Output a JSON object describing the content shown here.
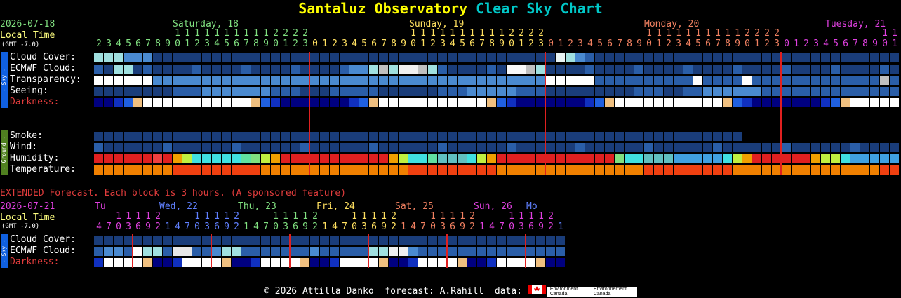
{
  "title": {
    "part1": "Santaluz Observatory",
    "part2": "Clear Sky Chart"
  },
  "header": {
    "date": "2026-07-21",
    "date_top": "2026-07-18",
    "local_time": "Local Time",
    "gmt": "(GMT -7.0)",
    "days": [
      {
        "label": "Saturday, 18",
        "color": "#80e080"
      },
      {
        "label": "Sunday, 19",
        "color": "#ffe060"
      },
      {
        "label": "Monday, 20",
        "color": "#f08060"
      },
      {
        "label": "Tuesday, 21",
        "color": "#e040e0"
      }
    ]
  },
  "hours": {
    "tens": [
      "",
      "",
      "",
      "",
      "",
      "",
      "",
      "",
      "1",
      "1",
      "1",
      "1",
      "1",
      "1",
      "1",
      "1",
      "1",
      "1",
      "2",
      "2",
      "2",
      "2",
      "",
      "",
      "",
      "",
      "",
      "",
      "",
      "",
      "",
      "",
      "",
      "",
      "",
      "",
      "",
      "",
      "",
      "",
      "",
      "",
      "",
      "",
      "",
      "",
      "",
      "",
      "",
      "",
      "",
      "",
      "",
      "",
      "",
      "",
      "",
      "",
      "",
      "",
      "",
      "",
      "",
      "",
      "",
      "",
      "",
      "",
      "",
      "",
      "",
      "",
      "",
      "",
      "",
      "",
      "",
      "",
      "",
      "",
      "",
      "",
      "",
      "",
      "",
      "",
      "",
      "",
      "",
      "",
      "",
      "",
      "",
      "",
      "",
      "",
      "",
      "",
      "",
      "",
      "",
      "",
      "",
      "",
      "",
      "",
      "",
      "",
      "",
      "",
      ""
    ],
    "units": [
      "2",
      "3",
      "4",
      "5",
      "6",
      "7",
      "8",
      "9",
      "0",
      "1",
      "2",
      "3",
      "4",
      "5",
      "6",
      "7",
      "8",
      "9",
      "0",
      "1",
      "2",
      "3"
    ]
  },
  "labels": {
    "cloud": "Cloud Cover:",
    "ecmwf": "ECMWF Cloud:",
    "transparency": "Transparency:",
    "seeing": "Seeing:",
    "darkness": "Darkness:",
    "smoke": "Smoke:",
    "wind": "Wind:",
    "humidity": "Humidity:",
    "temperature": "Temperature:",
    "sky_side": "- Sky -",
    "ground_side": "- Ground -"
  },
  "extended": {
    "heading": "EXTENDED Forecast. Each block is 3 hours. (A sponsored feature)",
    "date": "2026-07-21",
    "local_time": "Local Time",
    "gmt": "(GMT -7.0)",
    "days": [
      {
        "label": "Tu",
        "color": "#e040e0"
      },
      {
        "label": "Wed, 22",
        "color": "#6080ff"
      },
      {
        "label": "Thu, 23",
        "color": "#80e080"
      },
      {
        "label": "Fri, 24",
        "color": "#ffe060"
      },
      {
        "label": "Sat, 25",
        "color": "#f08060"
      },
      {
        "label": "Sun, 26",
        "color": "#e040e0"
      },
      {
        "label": "Mo",
        "color": "#6080ff"
      }
    ],
    "labels": {
      "cloud": "Cloud Cover:",
      "ecmwf": "ECMWF Cloud:",
      "darkness": "Darkness:"
    }
  },
  "footer": {
    "text": "© 2026 Attilla Danko  forecast: A.Rahill  data: ",
    "logo1": "Environment Canada",
    "logo2": "Environnement Canada"
  },
  "colors": {
    "accent_red": "#e02020",
    "title_yellow": "#ffff00",
    "title_cyan": "#00c8c8",
    "local_time": "#ffff80"
  }
}
